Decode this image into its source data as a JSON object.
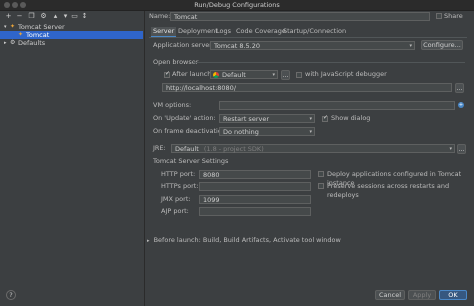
{
  "window": {
    "title": "Run/Debug Configurations"
  },
  "toolbar": {
    "icons": [
      "plus-icon",
      "minus-icon",
      "copy-icon",
      "wrench-icon",
      "arrow-up-icon",
      "arrow-down-icon",
      "folder-icon",
      "sort-icon"
    ]
  },
  "tree": {
    "items": [
      {
        "label": "Tomcat Server"
      },
      {
        "label": "Tomcat"
      },
      {
        "label": "Defaults"
      }
    ]
  },
  "config": {
    "name_label": "Name:",
    "name_value": "Tomcat",
    "share_label": "Share",
    "tabs": [
      "Server",
      "Deployment",
      "Logs",
      "Code Coverage",
      "Startup/Connection"
    ],
    "app_server_label": "Application server:",
    "app_server_value": "Tomcat 8.5.20",
    "configure_label": "Configure...",
    "open_browser_label": "Open browser",
    "after_launch_label": "After launch",
    "browser_value": "Default",
    "browser_more": "...",
    "js_debugger_label": "with JavaScript debugger",
    "url_value": "http://localhost:8080/",
    "url_more": "...",
    "vm_options_label": "VM options:",
    "on_update_label": "On 'Update' action:",
    "on_update_value": "Restart server",
    "show_dialog_label": "Show dialog",
    "on_frame_label": "On frame deactivation:",
    "on_frame_value": "Do nothing",
    "jre_label": "JRE:",
    "jre_value": "Default",
    "jre_hint": "(1.8 - project SDK)",
    "jre_more": "...",
    "tomcat_settings_label": "Tomcat Server Settings",
    "http_port_label": "HTTP port:",
    "http_port_value": "8080",
    "https_port_label": "HTTPs port:",
    "https_port_value": "",
    "jmx_port_label": "JMX port:",
    "jmx_port_value": "1099",
    "ajp_port_label": "AJP port:",
    "ajp_port_value": "",
    "deploy_tomcat_label": "Deploy applications configured in Tomcat instance",
    "preserve_sessions_label": "Preserve sessions across restarts and redeploys",
    "before_launch_label": "Before launch: Build, Build Artifacts, Activate tool window"
  },
  "footer": {
    "help_label": "?",
    "cancel_label": "Cancel",
    "apply_label": "Apply",
    "ok_label": "OK"
  },
  "colors": {
    "selection": "#2f65ca",
    "accent": "#4a88c7",
    "background": "#3c3f41"
  }
}
